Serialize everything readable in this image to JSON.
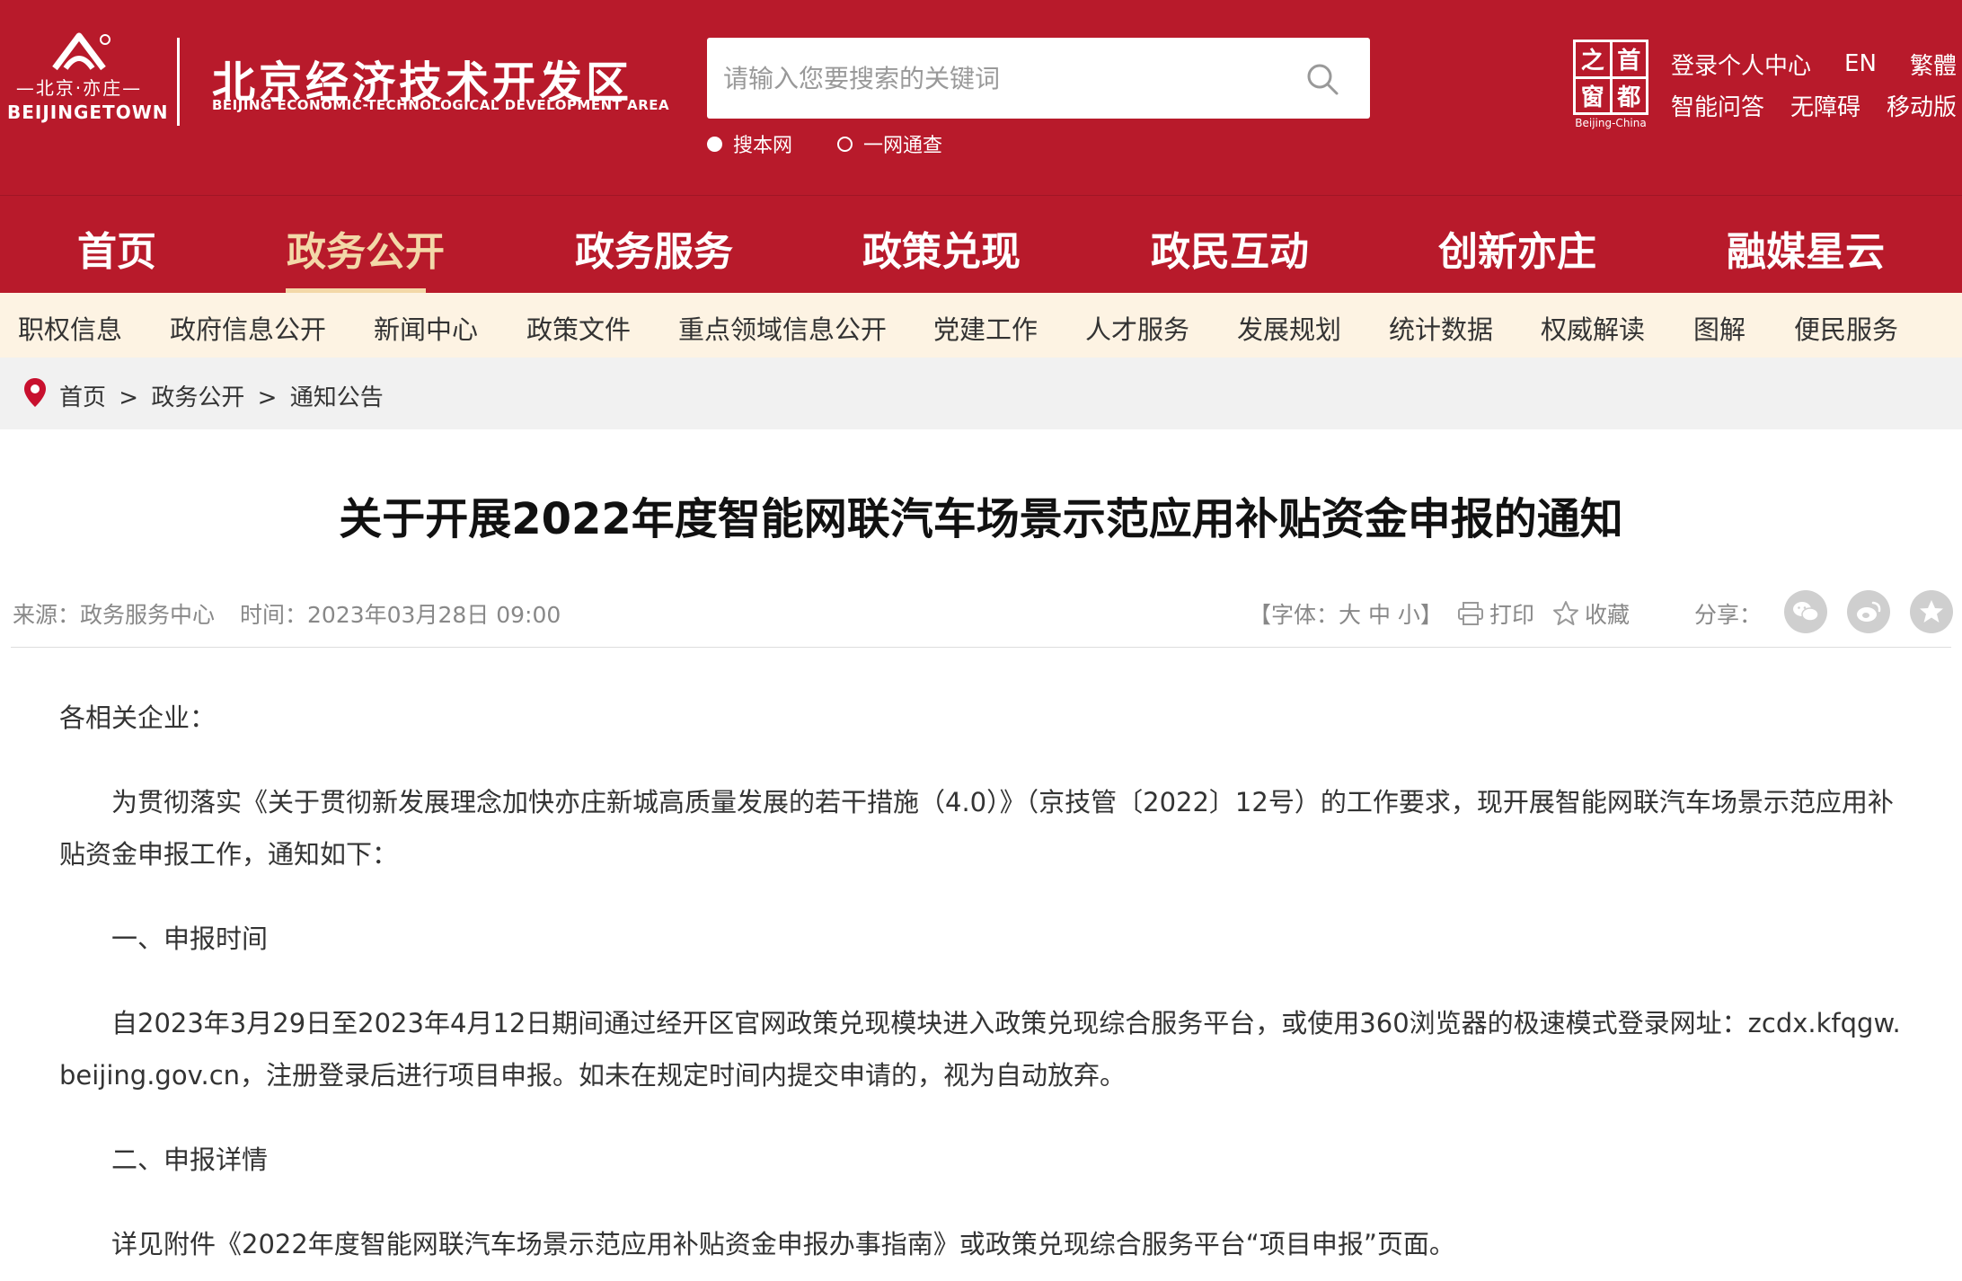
{
  "header": {
    "logo_cn_small": "—北京·亦庄—",
    "logo_en_small": "BEIJINGETOWN",
    "site_title": "北京经济技术开发区",
    "site_subtitle": "BEIJING ECONOMIC-TECHNOLOGICAL DEVELOPMENT AREA",
    "search_placeholder": "请输入您要搜索的关键词",
    "radio_options": [
      "搜本网",
      "一网通查"
    ],
    "capital_logo_chars": [
      "之",
      "首",
      "窗",
      "都"
    ],
    "capital_logo_caption": "Beijing-China",
    "top_links_row1": [
      "登录个人中心",
      "EN",
      "繁體"
    ],
    "top_links_row2": [
      "智能问答",
      "无障碍",
      "移动版"
    ]
  },
  "mainnav": {
    "items": [
      "首页",
      "政务公开",
      "政务服务",
      "政策兑现",
      "政民互动",
      "创新亦庄",
      "融媒星云"
    ],
    "active": "政务公开"
  },
  "subnav": {
    "items": [
      "职权信息",
      "政府信息公开",
      "新闻中心",
      "政策文件",
      "重点领域信息公开",
      "党建工作",
      "人才服务",
      "发展规划",
      "统计数据",
      "权威解读",
      "图解",
      "便民服务"
    ]
  },
  "breadcrumb": [
    "首页",
    "政务公开",
    "通知公告"
  ],
  "breadcrumb_sep": ">",
  "article": {
    "title": "关于开展2022年度智能网联汽车场景示范应用补贴资金申报的通知",
    "source": "来源：政务服务中心",
    "time": "时间：2023年03月28日 09:00",
    "font_size_label": "【字体：大 中 小】",
    "print_label": "打印",
    "favorite_label": "收藏",
    "share_label": "分享：",
    "paragraphs": [
      "各相关企业：",
      "为贯彻落实《关于贯彻新发展理念加快亦庄新城高质量发展的若干措施（4.0）》（京技管〔2022〕12号）的工作要求，现开展智能网联汽车场景示范应用补贴资金申报工作，通知如下：",
      "一、申报时间",
      "自2023年3月29日至2023年4月12日期间通过经开区官网政策兑现模块进入政策兑现综合服务平台，或使用360浏览器的极速模式登录网址：zcdx.kfqgw.beijing.gov.cn，注册登录后进行项目申报。如未在规定时间内提交申请的，视为自动放弃。",
      "二、申报详情",
      "详见附件《2022年度智能网联汽车场景示范应用补贴资金申报办事指南》或政策兑现综合服务平台“项目申报”页面。"
    ]
  },
  "colors": {
    "brand_red": "#b81a2b",
    "nav_active": "#f3d8a8",
    "subnav_bg": "#fdf3e3"
  }
}
